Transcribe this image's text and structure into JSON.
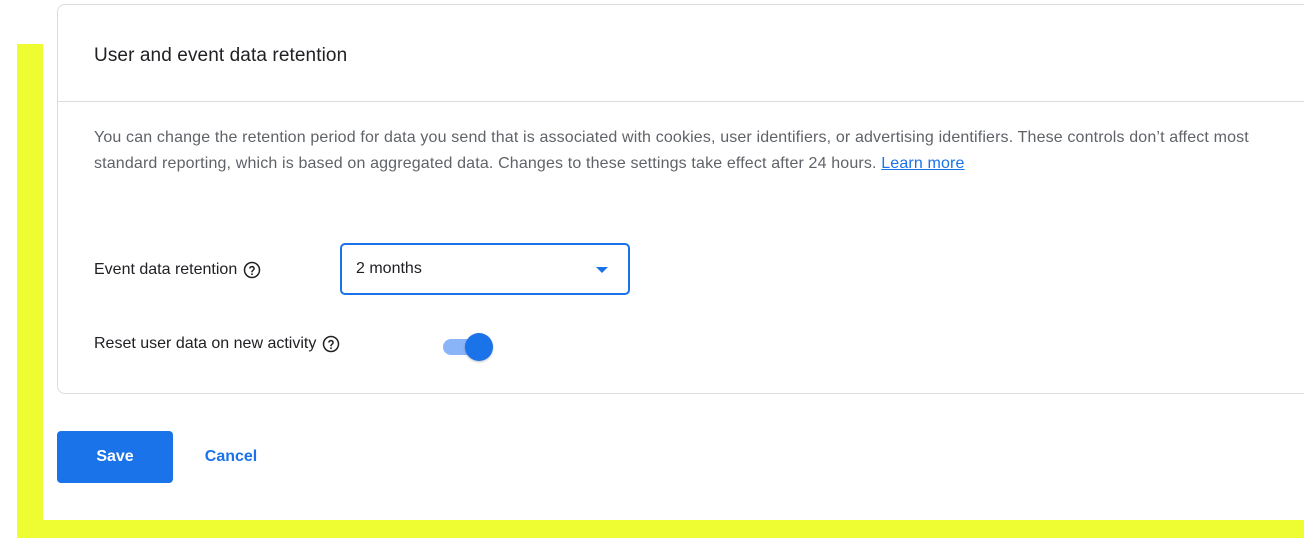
{
  "card": {
    "title": "User and event data retention",
    "description": "You can change the retention period for data you send that is associated with cookies, user identifiers, or advertising identifiers. These controls don’t affect most standard reporting, which is based on aggregated data. Changes to these settings take effect after 24 hours.",
    "learn_more": "Learn more"
  },
  "event_retention": {
    "label": "Event data retention",
    "selected_value": "2 months",
    "help_icon": "help-circle-icon",
    "caret_icon": "caret-down-icon"
  },
  "reset_user_data": {
    "label": "Reset user data on new activity",
    "help_icon": "help-circle-icon",
    "enabled": true
  },
  "actions": {
    "save_label": "Save",
    "cancel_label": "Cancel"
  },
  "colors": {
    "accent": "#1a73e8",
    "toggle_track": "#8ab4f8",
    "highlight": "#eefc32",
    "text_primary": "#202124",
    "text_secondary": "#5f6368",
    "border": "#dadce0"
  }
}
